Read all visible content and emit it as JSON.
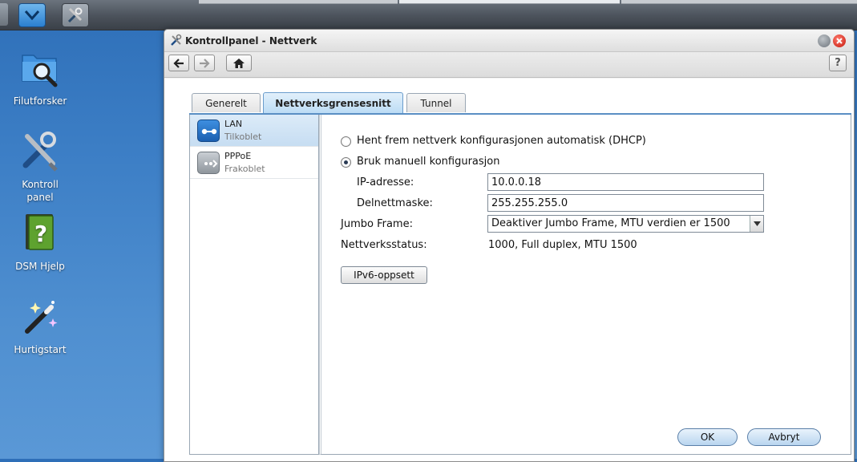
{
  "desktop": {
    "icons": [
      {
        "label": "Filutforsker"
      },
      {
        "label": "Kontroll\npanel"
      },
      {
        "label": "DSM Hjelp"
      },
      {
        "label": "Hurtigstart"
      }
    ]
  },
  "window": {
    "title": "Kontrollpanel - Nettverk",
    "help_label": "?"
  },
  "tabs": [
    {
      "label": "Generelt"
    },
    {
      "label": "Nettverksgrensesnitt"
    },
    {
      "label": "Tunnel"
    }
  ],
  "interfaces": [
    {
      "name": "LAN",
      "status": "Tilkoblet"
    },
    {
      "name": "PPPoE",
      "status": "Frakoblet"
    }
  ],
  "form": {
    "dhcp_label": "Hent frem nettverk konfigurasjonen automatisk (DHCP)",
    "manual_label": "Bruk manuell konfigurasjon",
    "ip_label": "IP-adresse:",
    "ip_value": "10.0.0.18",
    "mask_label": "Delnettmaske:",
    "mask_value": "255.255.255.0",
    "jumbo_label": "Jumbo Frame:",
    "jumbo_value": "Deaktiver Jumbo Frame, MTU verdien er 1500",
    "status_label": "Nettverksstatus:",
    "status_value": "1000, Full duplex, MTU 1500",
    "ipv6_button": "IPv6-oppsett"
  },
  "buttons": {
    "ok": "OK",
    "cancel": "Avbryt"
  }
}
